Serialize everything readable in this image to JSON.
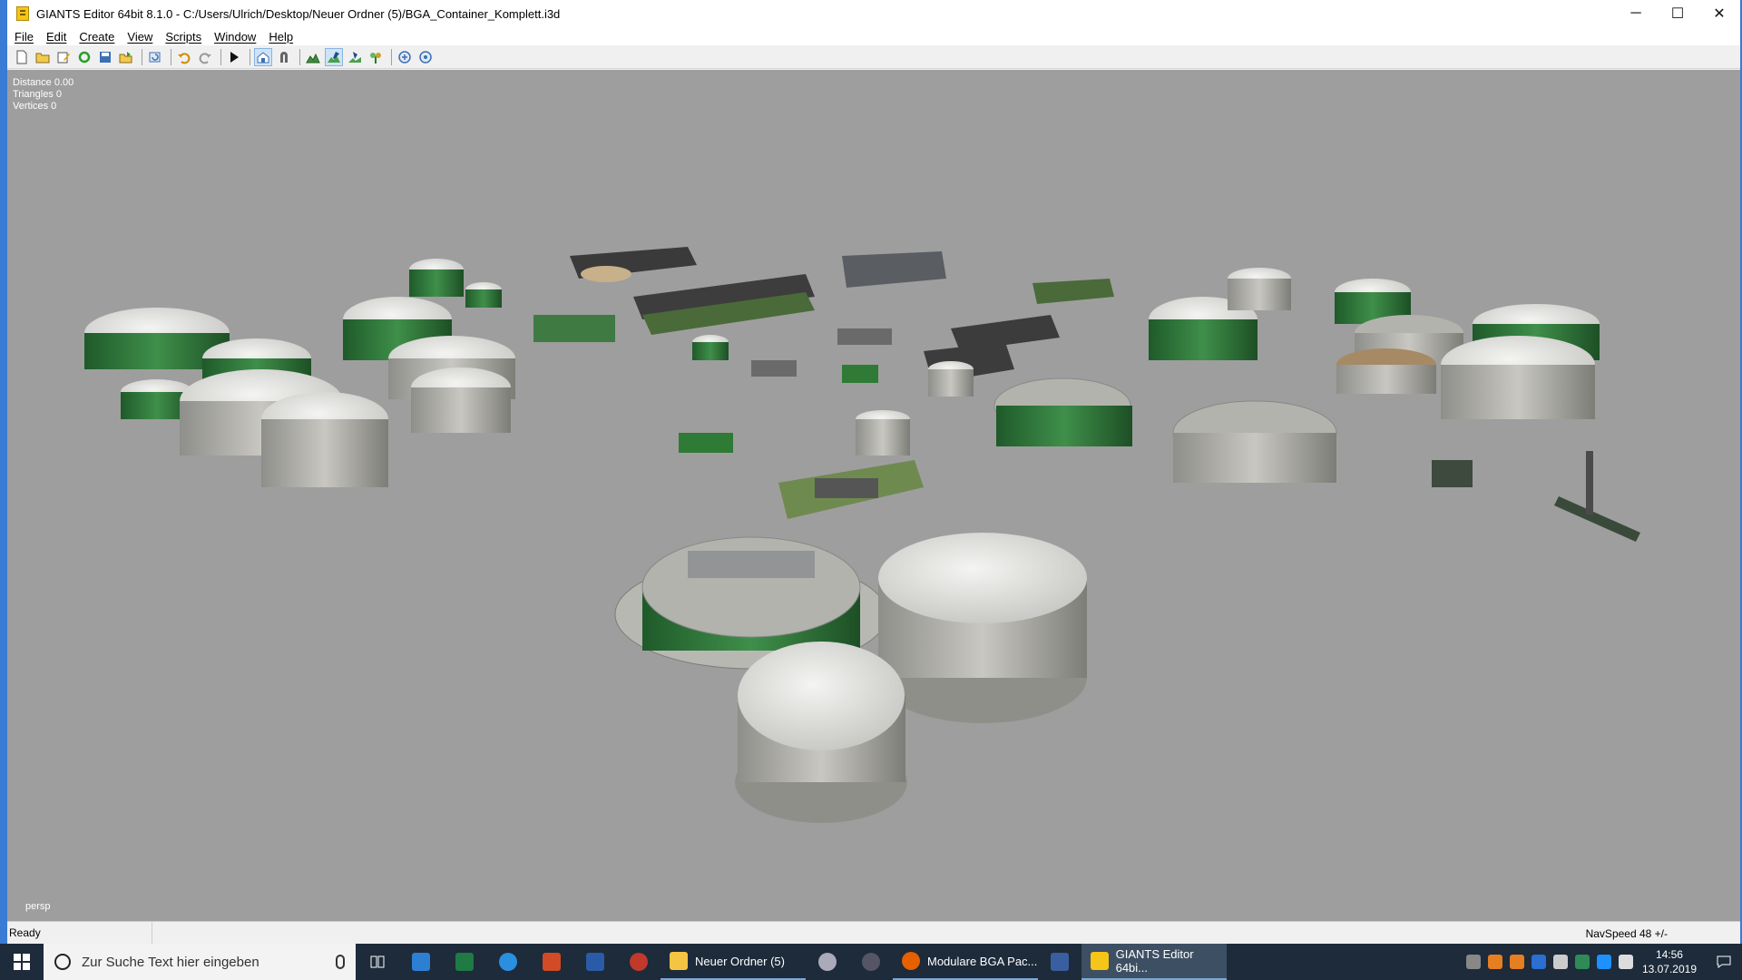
{
  "window": {
    "title": "GIANTS Editor 64bit 8.1.0 - C:/Users/Ulrich/Desktop/Neuer Ordner (5)/BGA_Container_Komplett.i3d",
    "minimize": "─",
    "maximize": "☐",
    "close": "✕"
  },
  "menu": {
    "items": [
      "File",
      "Edit",
      "Create",
      "View",
      "Scripts",
      "Window",
      "Help"
    ]
  },
  "toolbar": {
    "icons": [
      "new-file-icon",
      "open-folder-icon",
      "edit-icon",
      "refresh-icon",
      "save-icon",
      "export-icon",
      "reload-icon",
      "undo-icon",
      "redo-icon",
      "play-icon",
      "home-select-icon",
      "magnet-icon",
      "terrain-sculpt-icon",
      "terrain-paint-icon",
      "foliage-paint-icon",
      "plant-icon",
      "sync-icon",
      "settings-sync-icon"
    ]
  },
  "viewport": {
    "stats": {
      "distance": "Distance 0.00",
      "triangles": "Triangles 0",
      "vertices": "Vertices 0"
    },
    "camera_label": "persp",
    "background_color": "#9e9e9e"
  },
  "status": {
    "left": "Ready",
    "right": "NavSpeed 48 +/-"
  },
  "taskbar": {
    "search_placeholder": "Zur Suche Text hier eingeben",
    "apps": [
      {
        "name": "explorer",
        "label": "Neuer Ordner (5)",
        "color": "#f4c542"
      },
      {
        "name": "firefox",
        "label": "Modulare BGA Pac...",
        "color": "#e66000"
      },
      {
        "name": "giants-editor",
        "label": "GIANTS Editor 64bi...",
        "color": "#f5c518"
      }
    ],
    "clock": {
      "time": "14:56",
      "date": "13.07.2019"
    }
  }
}
